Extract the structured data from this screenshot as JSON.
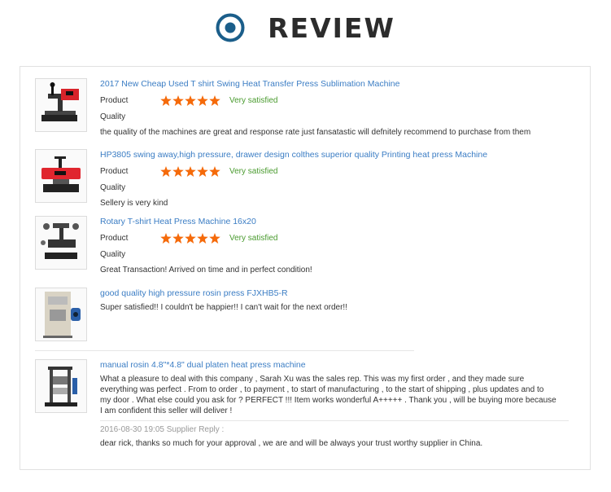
{
  "header": {
    "title": "REVIEW"
  },
  "colors": {
    "accent": "#1b5e8a",
    "star": "#f56a0a",
    "link": "#3b7dc4",
    "satisfied": "#4a9b2f"
  },
  "reviews": [
    {
      "product_title": "2017 New Cheap Used T shirt Swing Heat Transfer Press Sublimation Machine",
      "product_label": "Product",
      "rating": 5,
      "rating_text": "Very satisfied",
      "quality_label": "Quality",
      "comment": "the quality of the machines are great and response rate just fansatastic will defnitely recommend to purchase from them"
    },
    {
      "product_title": "HP3805 swing away,high pressure, drawer design colthes superior quality Printing heat press Machine",
      "product_label": "Product",
      "rating": 5,
      "rating_text": "Very satisfied",
      "quality_label": "Quality",
      "comment": "Sellery is very kind"
    },
    {
      "product_title": "Rotary T-shirt Heat Press Machine 16x20",
      "product_label": "Product",
      "rating": 5,
      "rating_text": "Very satisfied",
      "quality_label": "Quality",
      "comment": "Great Transaction! Arrived on time and in perfect condition!"
    },
    {
      "product_title": "good quality high pressure rosin press FJXHB5-R",
      "comment": "Super satisfied!! I couldn't be happier!! I can't wait for the next order!!"
    },
    {
      "product_title": "manual rosin 4.8\"*4.8\" dual platen heat press machine",
      "comment_lines": [
        "What a pleasure to deal with this company , Sarah Xu was the sales rep.  This was my first order , and they made sure",
        "everything was perfect .  From to order , to payment , to start of manufacturing , to the start of shipping , plus updates and to",
        "my door .  What else could you ask for ? PERFECT !!!   Item works wonderful A+++++ .  Thank you , will be buying more because",
        "I am confident this seller will deliver !"
      ],
      "reply_meta": "2016-08-30 19:05  Supplier Reply :",
      "reply_text": "dear rick, thanks so much for your approval , we are and will be always your trust worthy supplier in China."
    }
  ]
}
